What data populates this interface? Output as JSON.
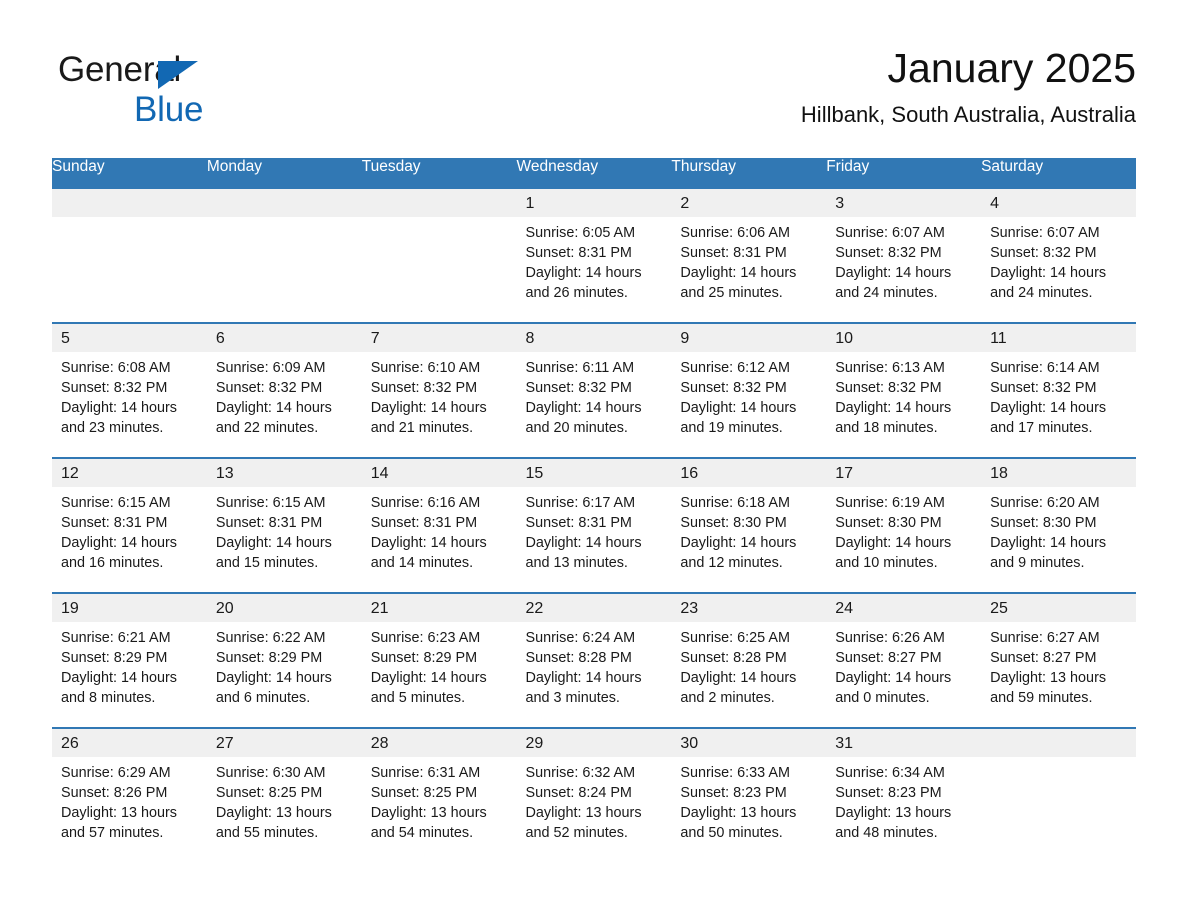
{
  "brand": {
    "name_part1": "General",
    "name_part2": "Blue",
    "accent_color": "#1268b3"
  },
  "header": {
    "title": "January 2025",
    "subtitle": "Hillbank, South Australia, Australia"
  },
  "theme": {
    "header_bar_color": "#3178b4",
    "daynum_band_color": "#f0f0f0",
    "cell_background": "#ffffff",
    "text_color": "#1a1a1a"
  },
  "calendar": {
    "weekday_headers": [
      "Sunday",
      "Monday",
      "Tuesday",
      "Wednesday",
      "Thursday",
      "Friday",
      "Saturday"
    ],
    "weeks": [
      [
        {
          "day": "",
          "sunrise": "",
          "sunset": "",
          "daylight_line1": "",
          "daylight_line2": "",
          "empty": true
        },
        {
          "day": "",
          "sunrise": "",
          "sunset": "",
          "daylight_line1": "",
          "daylight_line2": "",
          "empty": true
        },
        {
          "day": "",
          "sunrise": "",
          "sunset": "",
          "daylight_line1": "",
          "daylight_line2": "",
          "empty": true
        },
        {
          "day": "1",
          "sunrise": "Sunrise: 6:05 AM",
          "sunset": "Sunset: 8:31 PM",
          "daylight_line1": "Daylight: 14 hours",
          "daylight_line2": "and 26 minutes.",
          "empty": false
        },
        {
          "day": "2",
          "sunrise": "Sunrise: 6:06 AM",
          "sunset": "Sunset: 8:31 PM",
          "daylight_line1": "Daylight: 14 hours",
          "daylight_line2": "and 25 minutes.",
          "empty": false
        },
        {
          "day": "3",
          "sunrise": "Sunrise: 6:07 AM",
          "sunset": "Sunset: 8:32 PM",
          "daylight_line1": "Daylight: 14 hours",
          "daylight_line2": "and 24 minutes.",
          "empty": false
        },
        {
          "day": "4",
          "sunrise": "Sunrise: 6:07 AM",
          "sunset": "Sunset: 8:32 PM",
          "daylight_line1": "Daylight: 14 hours",
          "daylight_line2": "and 24 minutes.",
          "empty": false
        }
      ],
      [
        {
          "day": "5",
          "sunrise": "Sunrise: 6:08 AM",
          "sunset": "Sunset: 8:32 PM",
          "daylight_line1": "Daylight: 14 hours",
          "daylight_line2": "and 23 minutes.",
          "empty": false
        },
        {
          "day": "6",
          "sunrise": "Sunrise: 6:09 AM",
          "sunset": "Sunset: 8:32 PM",
          "daylight_line1": "Daylight: 14 hours",
          "daylight_line2": "and 22 minutes.",
          "empty": false
        },
        {
          "day": "7",
          "sunrise": "Sunrise: 6:10 AM",
          "sunset": "Sunset: 8:32 PM",
          "daylight_line1": "Daylight: 14 hours",
          "daylight_line2": "and 21 minutes.",
          "empty": false
        },
        {
          "day": "8",
          "sunrise": "Sunrise: 6:11 AM",
          "sunset": "Sunset: 8:32 PM",
          "daylight_line1": "Daylight: 14 hours",
          "daylight_line2": "and 20 minutes.",
          "empty": false
        },
        {
          "day": "9",
          "sunrise": "Sunrise: 6:12 AM",
          "sunset": "Sunset: 8:32 PM",
          "daylight_line1": "Daylight: 14 hours",
          "daylight_line2": "and 19 minutes.",
          "empty": false
        },
        {
          "day": "10",
          "sunrise": "Sunrise: 6:13 AM",
          "sunset": "Sunset: 8:32 PM",
          "daylight_line1": "Daylight: 14 hours",
          "daylight_line2": "and 18 minutes.",
          "empty": false
        },
        {
          "day": "11",
          "sunrise": "Sunrise: 6:14 AM",
          "sunset": "Sunset: 8:32 PM",
          "daylight_line1": "Daylight: 14 hours",
          "daylight_line2": "and 17 minutes.",
          "empty": false
        }
      ],
      [
        {
          "day": "12",
          "sunrise": "Sunrise: 6:15 AM",
          "sunset": "Sunset: 8:31 PM",
          "daylight_line1": "Daylight: 14 hours",
          "daylight_line2": "and 16 minutes.",
          "empty": false
        },
        {
          "day": "13",
          "sunrise": "Sunrise: 6:15 AM",
          "sunset": "Sunset: 8:31 PM",
          "daylight_line1": "Daylight: 14 hours",
          "daylight_line2": "and 15 minutes.",
          "empty": false
        },
        {
          "day": "14",
          "sunrise": "Sunrise: 6:16 AM",
          "sunset": "Sunset: 8:31 PM",
          "daylight_line1": "Daylight: 14 hours",
          "daylight_line2": "and 14 minutes.",
          "empty": false
        },
        {
          "day": "15",
          "sunrise": "Sunrise: 6:17 AM",
          "sunset": "Sunset: 8:31 PM",
          "daylight_line1": "Daylight: 14 hours",
          "daylight_line2": "and 13 minutes.",
          "empty": false
        },
        {
          "day": "16",
          "sunrise": "Sunrise: 6:18 AM",
          "sunset": "Sunset: 8:30 PM",
          "daylight_line1": "Daylight: 14 hours",
          "daylight_line2": "and 12 minutes.",
          "empty": false
        },
        {
          "day": "17",
          "sunrise": "Sunrise: 6:19 AM",
          "sunset": "Sunset: 8:30 PM",
          "daylight_line1": "Daylight: 14 hours",
          "daylight_line2": "and 10 minutes.",
          "empty": false
        },
        {
          "day": "18",
          "sunrise": "Sunrise: 6:20 AM",
          "sunset": "Sunset: 8:30 PM",
          "daylight_line1": "Daylight: 14 hours",
          "daylight_line2": "and 9 minutes.",
          "empty": false
        }
      ],
      [
        {
          "day": "19",
          "sunrise": "Sunrise: 6:21 AM",
          "sunset": "Sunset: 8:29 PM",
          "daylight_line1": "Daylight: 14 hours",
          "daylight_line2": "and 8 minutes.",
          "empty": false
        },
        {
          "day": "20",
          "sunrise": "Sunrise: 6:22 AM",
          "sunset": "Sunset: 8:29 PM",
          "daylight_line1": "Daylight: 14 hours",
          "daylight_line2": "and 6 minutes.",
          "empty": false
        },
        {
          "day": "21",
          "sunrise": "Sunrise: 6:23 AM",
          "sunset": "Sunset: 8:29 PM",
          "daylight_line1": "Daylight: 14 hours",
          "daylight_line2": "and 5 minutes.",
          "empty": false
        },
        {
          "day": "22",
          "sunrise": "Sunrise: 6:24 AM",
          "sunset": "Sunset: 8:28 PM",
          "daylight_line1": "Daylight: 14 hours",
          "daylight_line2": "and 3 minutes.",
          "empty": false
        },
        {
          "day": "23",
          "sunrise": "Sunrise: 6:25 AM",
          "sunset": "Sunset: 8:28 PM",
          "daylight_line1": "Daylight: 14 hours",
          "daylight_line2": "and 2 minutes.",
          "empty": false
        },
        {
          "day": "24",
          "sunrise": "Sunrise: 6:26 AM",
          "sunset": "Sunset: 8:27 PM",
          "daylight_line1": "Daylight: 14 hours",
          "daylight_line2": "and 0 minutes.",
          "empty": false
        },
        {
          "day": "25",
          "sunrise": "Sunrise: 6:27 AM",
          "sunset": "Sunset: 8:27 PM",
          "daylight_line1": "Daylight: 13 hours",
          "daylight_line2": "and 59 minutes.",
          "empty": false
        }
      ],
      [
        {
          "day": "26",
          "sunrise": "Sunrise: 6:29 AM",
          "sunset": "Sunset: 8:26 PM",
          "daylight_line1": "Daylight: 13 hours",
          "daylight_line2": "and 57 minutes.",
          "empty": false
        },
        {
          "day": "27",
          "sunrise": "Sunrise: 6:30 AM",
          "sunset": "Sunset: 8:25 PM",
          "daylight_line1": "Daylight: 13 hours",
          "daylight_line2": "and 55 minutes.",
          "empty": false
        },
        {
          "day": "28",
          "sunrise": "Sunrise: 6:31 AM",
          "sunset": "Sunset: 8:25 PM",
          "daylight_line1": "Daylight: 13 hours",
          "daylight_line2": "and 54 minutes.",
          "empty": false
        },
        {
          "day": "29",
          "sunrise": "Sunrise: 6:32 AM",
          "sunset": "Sunset: 8:24 PM",
          "daylight_line1": "Daylight: 13 hours",
          "daylight_line2": "and 52 minutes.",
          "empty": false
        },
        {
          "day": "30",
          "sunrise": "Sunrise: 6:33 AM",
          "sunset": "Sunset: 8:23 PM",
          "daylight_line1": "Daylight: 13 hours",
          "daylight_line2": "and 50 minutes.",
          "empty": false
        },
        {
          "day": "31",
          "sunrise": "Sunrise: 6:34 AM",
          "sunset": "Sunset: 8:23 PM",
          "daylight_line1": "Daylight: 13 hours",
          "daylight_line2": "and 48 minutes.",
          "empty": false
        },
        {
          "day": "",
          "sunrise": "",
          "sunset": "",
          "daylight_line1": "",
          "daylight_line2": "",
          "empty": true
        }
      ]
    ]
  }
}
